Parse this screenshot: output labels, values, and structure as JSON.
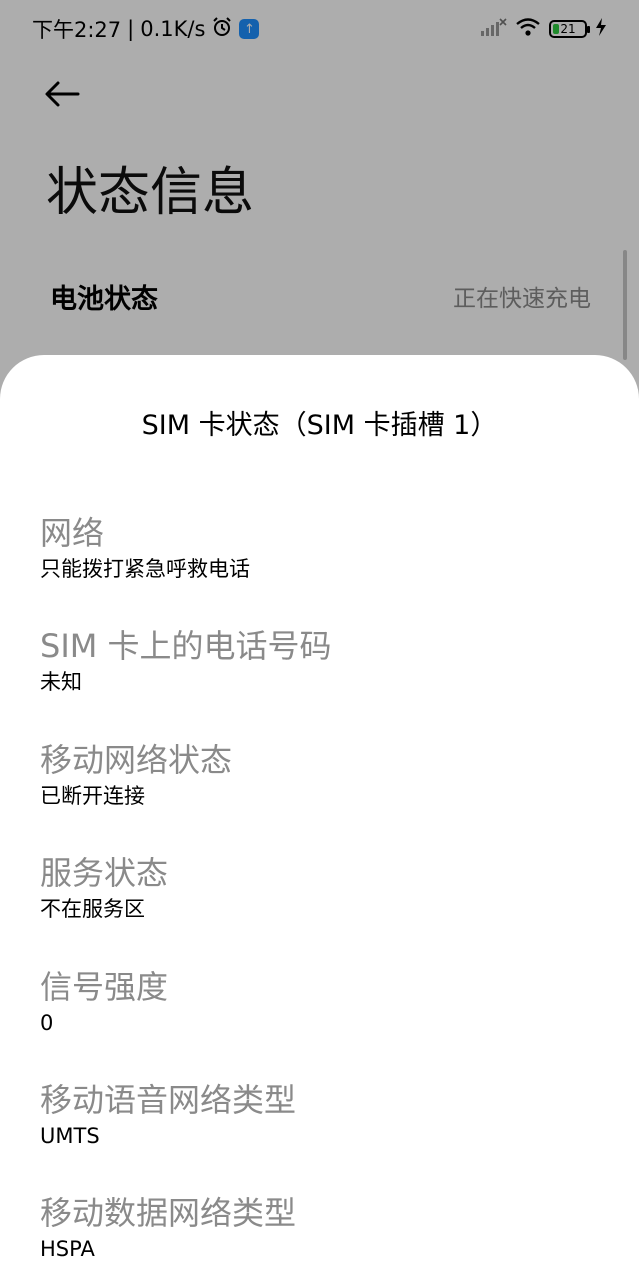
{
  "status_bar": {
    "time": "下午2:27",
    "speed": "0.1K/s",
    "battery_level": "21"
  },
  "page": {
    "title": "状态信息",
    "battery_row": {
      "label": "电池状态",
      "value": "正在快速充电"
    }
  },
  "dialog": {
    "title": "SIM 卡状态（SIM 卡插槽 1）",
    "items": [
      {
        "label": "网络",
        "value": "只能拨打紧急呼救电话"
      },
      {
        "label": "SIM 卡上的电话号码",
        "value": "未知"
      },
      {
        "label": "移动网络状态",
        "value": "已断开连接"
      },
      {
        "label": "服务状态",
        "value": "不在服务区"
      },
      {
        "label": "信号强度",
        "value": "0"
      },
      {
        "label": "移动语音网络类型",
        "value": "UMTS"
      },
      {
        "label": "移动数据网络类型",
        "value": "HSPA"
      }
    ]
  },
  "icons": {
    "back": "back-arrow-icon",
    "alarm": "alarm-icon",
    "app_badge": "upload-app-icon",
    "signal": "signal-icon",
    "wifi": "wifi-icon",
    "battery": "battery-icon",
    "charging": "charging-bolt-icon"
  }
}
